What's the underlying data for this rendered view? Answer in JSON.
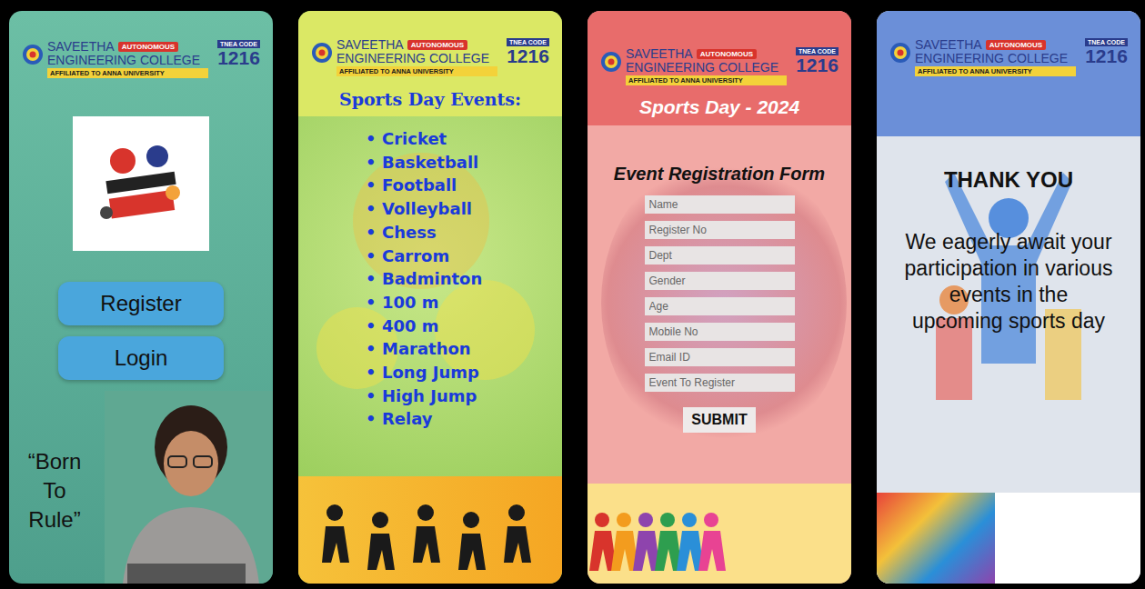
{
  "logo": {
    "name": "SAVEETHA",
    "subtitle": "ENGINEERING COLLEGE",
    "badge": "AUTONOMOUS",
    "affiliation": "AFFILIATED TO ANNA UNIVERSITY",
    "code_label": "TNEA CODE",
    "code": "1216"
  },
  "screens": [
    {
      "kind": "home",
      "buttons": [
        "Register",
        "Login"
      ],
      "quote": [
        "“Born",
        "To",
        "Rule”"
      ]
    },
    {
      "kind": "events",
      "title": "Sports Day Events:",
      "bullet": "•",
      "events": [
        "Cricket",
        "Basketball",
        "Football",
        "Volleyball",
        "Chess",
        "Carrom",
        "Badminton",
        "100 m",
        "400 m",
        "Marathon",
        "Long Jump",
        "High Jump",
        "Relay"
      ]
    },
    {
      "kind": "form",
      "title": "Sports Day - 2024",
      "form_title": "Event Registration Form",
      "fields": [
        "Name",
        "Register No",
        "Dept",
        "Gender",
        "Age",
        "Mobile No",
        "Email ID",
        "Event To Register"
      ],
      "submit": "SUBMIT"
    },
    {
      "kind": "thanks",
      "title": "THANK YOU",
      "message": "We eagerly await your participation in various events in the upcoming sports day"
    }
  ]
}
